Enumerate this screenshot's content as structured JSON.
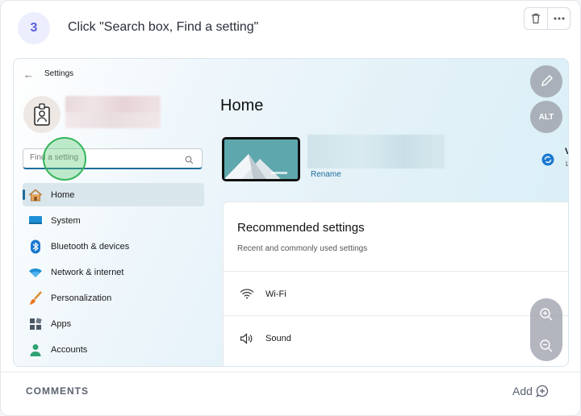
{
  "step": {
    "number": "3",
    "title": "Click \"Search box, Find a setting\""
  },
  "top_actions": {
    "delete_icon": "trash-icon",
    "more_icon": "more-horizontal-icon"
  },
  "screenshot": {
    "window_title": "Settings",
    "search": {
      "placeholder": "Find a setting"
    },
    "nav": [
      {
        "label": "Home",
        "icon": "home-icon",
        "active": true
      },
      {
        "label": "System",
        "icon": "monitor-icon"
      },
      {
        "label": "Bluetooth & devices",
        "icon": "bluetooth-icon"
      },
      {
        "label": "Network & internet",
        "icon": "wifi-icon"
      },
      {
        "label": "Personalization",
        "icon": "brush-icon"
      },
      {
        "label": "Apps",
        "icon": "apps-icon"
      },
      {
        "label": "Accounts",
        "icon": "person-icon"
      }
    ],
    "main": {
      "title": "Home",
      "rename_label": "Rename",
      "edge_fragments": {
        "v": "V",
        "l": "L"
      },
      "recommended": {
        "title": "Recommended settings",
        "subtitle": "Recent and commonly used settings",
        "rows": [
          {
            "label": "Wi-Fi",
            "icon": "wifi-icon"
          },
          {
            "label": "Sound",
            "icon": "speaker-icon"
          }
        ]
      }
    },
    "overlay": {
      "edit_icon": "pencil-icon",
      "alt_label": "ALT",
      "zoom_in_icon": "zoom-in-icon",
      "zoom_out_icon": "zoom-out-icon"
    }
  },
  "footer": {
    "comments_label": "COMMENTS",
    "add_label": "Add"
  },
  "colors": {
    "accent": "#5b5fd6",
    "click_marker": "#35b55a",
    "win_accent": "#1f6b9a"
  }
}
